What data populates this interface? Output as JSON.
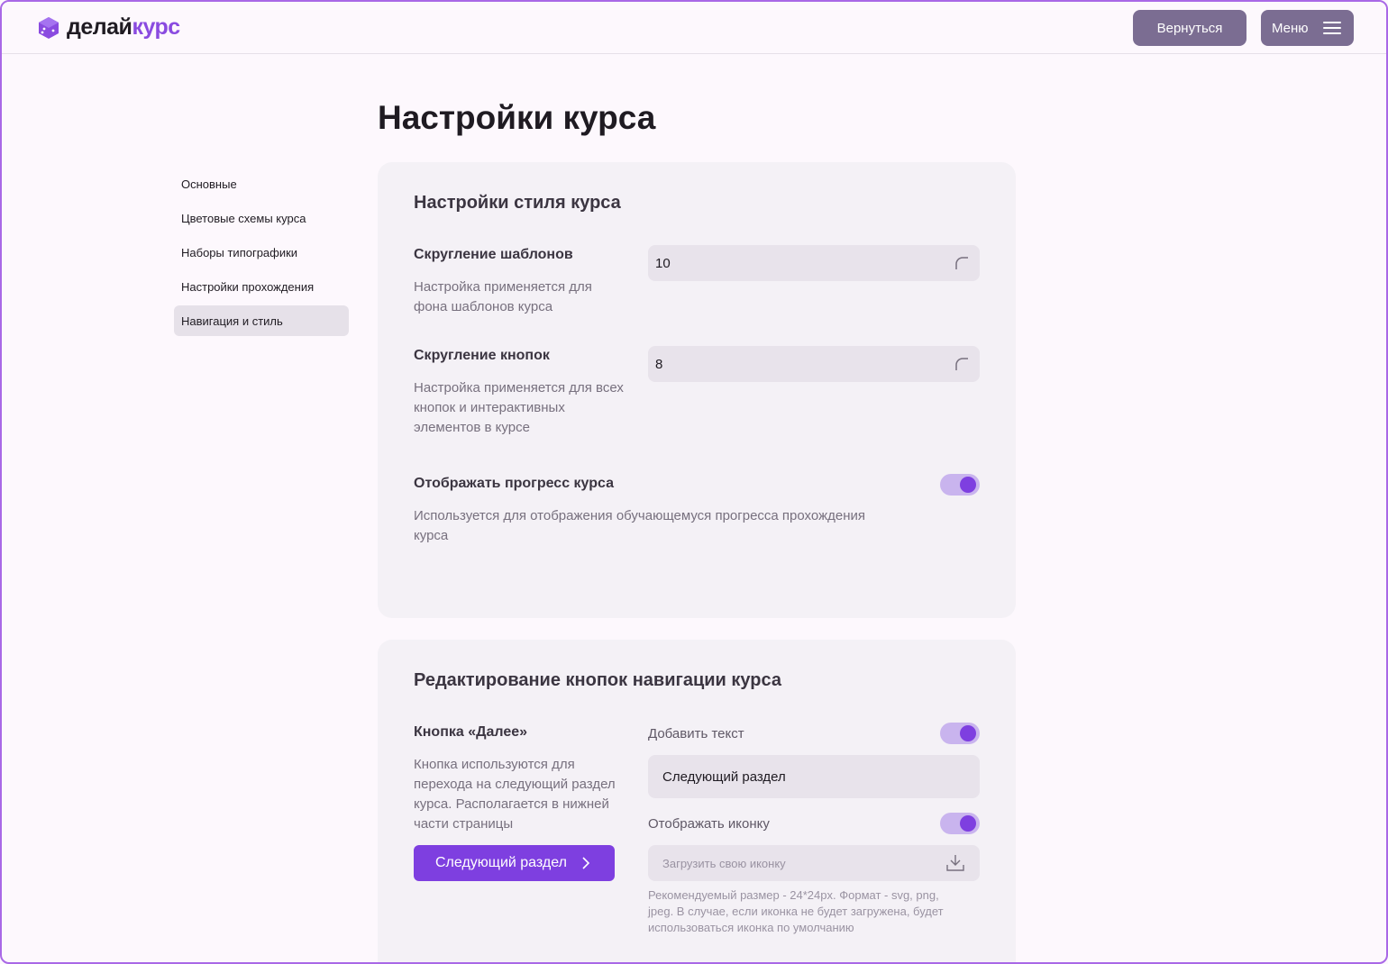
{
  "header": {
    "logo_part1": "делай",
    "logo_part2": "курс",
    "back_button": "Вернуться",
    "menu_button": "Меню"
  },
  "colors": {
    "accent": "#7e3fe0",
    "header_button": "#7b6d92",
    "card_bg": "#f4f1f6",
    "input_bg": "#e8e3eb"
  },
  "sidebar": {
    "items": [
      {
        "label": "Основные"
      },
      {
        "label": "Цветовые схемы курса"
      },
      {
        "label": "Наборы типографики"
      },
      {
        "label": "Настройки прохождения"
      },
      {
        "label": "Навигация и стиль",
        "active": true
      }
    ]
  },
  "page": {
    "title": "Настройки курса"
  },
  "style_card": {
    "title": "Настройки стиля курса",
    "template_rounding": {
      "label": "Скругление шаблонов",
      "desc_line1": "Настройка применяется для",
      "desc_line2": "фона шаблонов курса",
      "value": "10"
    },
    "button_rounding": {
      "label": "Скругление кнопок",
      "desc_line1": "Настройка применяется для всех",
      "desc_line2": "кнопок и интерактивных",
      "desc_line3": "элементов в курсе",
      "value": "8"
    },
    "show_progress": {
      "label": "Отображать прогресс курса",
      "desc_line1": "Используется для отображения обучающемуся прогресса прохождения",
      "desc_line2": "курса",
      "enabled": true
    }
  },
  "nav_card": {
    "title": "Редактирование кнопок навигации курса",
    "next_button": {
      "label": "Кнопка «Далее»",
      "desc_line1": "Кнопка используются для",
      "desc_line2": "перехода на следующий раздел",
      "desc_line3": "курса. Располагается в нижней",
      "desc_line4": "части страницы",
      "preview_label": "Следующий раздел"
    },
    "add_text": {
      "label": "Добавить текст",
      "enabled": true,
      "value": "Следующий раздел"
    },
    "show_icon": {
      "label": "Отображать иконку",
      "enabled": true
    },
    "upload": {
      "placeholder": "Загрузить свою иконку",
      "hint_line1": "Рекомендуемый размер - 24*24px. Формат - svg, png,",
      "hint_line2": "jpeg. В случае, если иконка не будет загружена, будет",
      "hint_line3": "использоваться иконка по умолчанию"
    }
  }
}
